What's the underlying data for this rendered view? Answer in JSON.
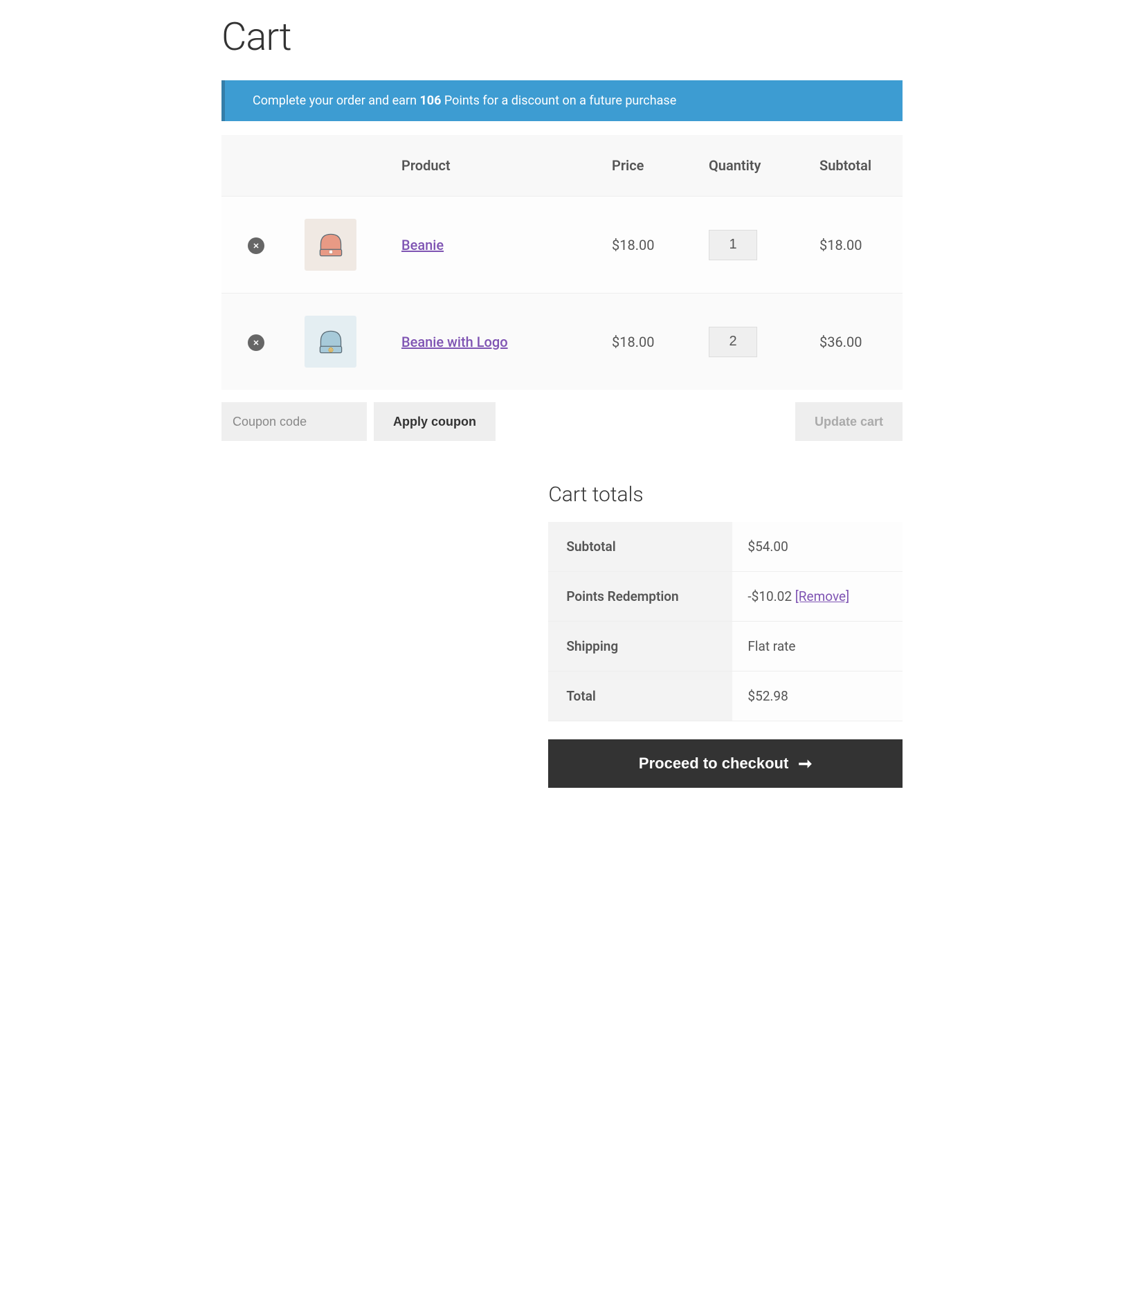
{
  "page_title": "Cart",
  "banner": {
    "prefix": "Complete your order and earn ",
    "points": "106",
    "suffix": " Points for a discount on a future purchase"
  },
  "table_headers": {
    "product": "Product",
    "price": "Price",
    "quantity": "Quantity",
    "subtotal": "Subtotal"
  },
  "items": [
    {
      "name": "Beanie",
      "price": "$18.00",
      "quantity": "1",
      "subtotal": "$18.00",
      "thumb_bg": "#f0e9e3",
      "thumb_color": "#e89a85"
    },
    {
      "name": "Beanie with Logo",
      "price": "$18.00",
      "quantity": "2",
      "subtotal": "$36.00",
      "thumb_bg": "#e4eef2",
      "thumb_color": "#a7cad9"
    }
  ],
  "coupon": {
    "placeholder": "Coupon code",
    "apply_label": "Apply coupon"
  },
  "update_cart_label": "Update cart",
  "totals": {
    "title": "Cart totals",
    "rows": {
      "subtotal_label": "Subtotal",
      "subtotal_value": "$54.00",
      "points_label": "Points Redemption",
      "points_value": "-$10.02 ",
      "points_remove": "[Remove]",
      "shipping_label": "Shipping",
      "shipping_value": "Flat rate",
      "total_label": "Total",
      "total_value": "$52.98"
    }
  },
  "checkout_label": "Proceed to checkout"
}
